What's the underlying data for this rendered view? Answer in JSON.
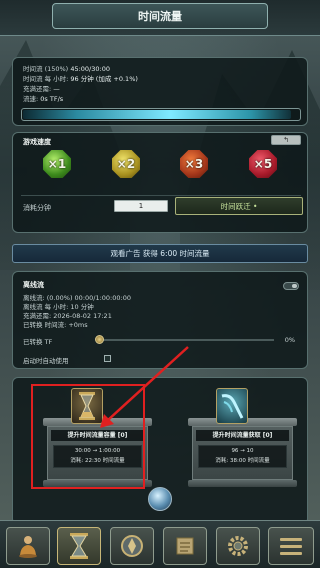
{
  "header": {
    "title": "时间流量"
  },
  "flow_panel": {
    "line1_label": "时间流 (150%)",
    "line1_value": "45:00/30:00",
    "line2_label": "时间流 每 小时:",
    "line2_value": "96 分钟 (加成 +0.1%)",
    "line3_label": "充满还需:",
    "line3_value": "—",
    "line4_label": "流速:",
    "line4_value": "0s TF/s",
    "bar_fill_fraction": 0.97
  },
  "speed_panel": {
    "title": "游戏速度",
    "corner_button": "↰",
    "multipliers": [
      "×1",
      "×2",
      "×3",
      "×5"
    ],
    "colors": [
      "#3c8a1c",
      "#a8911f",
      "#a4361a",
      "#a81a2a"
    ],
    "consume_label": "消耗分钟",
    "consume_value": "1",
    "jump_button": "时间跃迁 •"
  },
  "ad_button": {
    "label": "观看广告 获得 6:00 时间流量"
  },
  "offline_panel": {
    "title": "离线流",
    "line1": "离线流: (0.00%) 00:00/1:00:00:00",
    "line2": "离线流 每 小时: 10 分钟",
    "line3": "充满还需: 2026-08-02 17:21",
    "line4": "已转换 时间流: +0ms",
    "converted_label": "已转换 TF",
    "converted_value": "0%",
    "auto_use_label": "启动时自动使用"
  },
  "upgrades": [
    {
      "title": "提升时间流量容量 [0]",
      "line1": "30:00 → 1:00:00",
      "line2": "消耗: 22:30 时间流量",
      "icon": "hourglass-icon"
    },
    {
      "title": "提升时间流量获取 [0]",
      "line1": "96 → 10",
      "line2": "消耗: 38:00 时间流量",
      "icon": "waterfall-icon"
    }
  ],
  "bottom_nav": [
    {
      "name": "hero",
      "icon": "monk-icon"
    },
    {
      "name": "time",
      "icon": "hourglass-icon"
    },
    {
      "name": "emblem",
      "icon": "shield-emblem-icon"
    },
    {
      "name": "scroll",
      "icon": "scroll-icon"
    },
    {
      "name": "settings",
      "icon": "gear-icon"
    },
    {
      "name": "menu",
      "icon": "menu-icon"
    }
  ]
}
